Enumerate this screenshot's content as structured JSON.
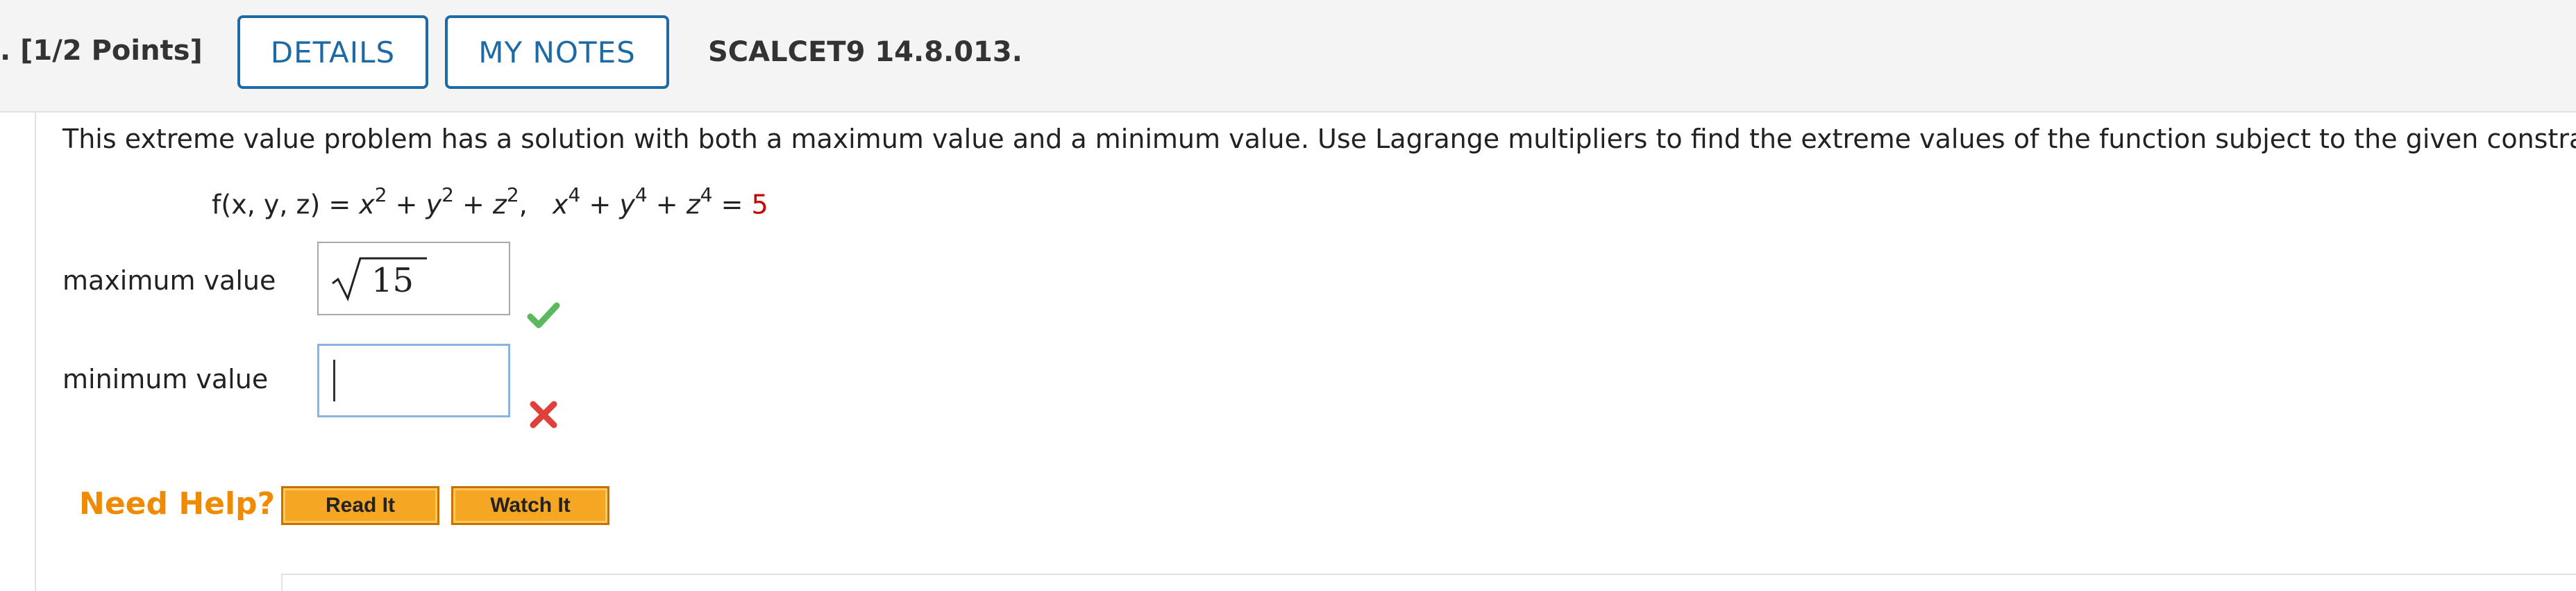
{
  "header": {
    "points": ". [1/2 Points]",
    "details_label": "DETAILS",
    "notes_label": "MY NOTES",
    "course_code": "SCALCET9 14.8.013."
  },
  "question": {
    "text": "This extreme value problem has a solution with both a maximum value and a minimum value. Use Lagrange multipliers to find the extreme values of the function subject to the given constraint.",
    "formula": {
      "f_lhs": "f(x, y, z) = ",
      "x": "x",
      "y": "y",
      "z": "z",
      "exp_2": "2",
      "exp_4": "4",
      "plus": " + ",
      "comma": ",",
      "equals": " = ",
      "constraint_value": "5"
    }
  },
  "answers": {
    "max_label": "maximum value",
    "max_value": "15",
    "max_status": "correct",
    "min_label": "minimum value",
    "min_value": "",
    "min_status": "incorrect"
  },
  "help": {
    "label": "Need Help?",
    "read_label": "Read It",
    "watch_label": "Watch It"
  },
  "colors": {
    "accent_blue": "#1e6aa5",
    "correct_green": "#5cb85c",
    "incorrect_red": "#e0403a",
    "help_orange": "#f08a00",
    "constraint_red": "#cc0000"
  },
  "icons": {
    "correct": "check-icon",
    "incorrect": "x-icon"
  }
}
